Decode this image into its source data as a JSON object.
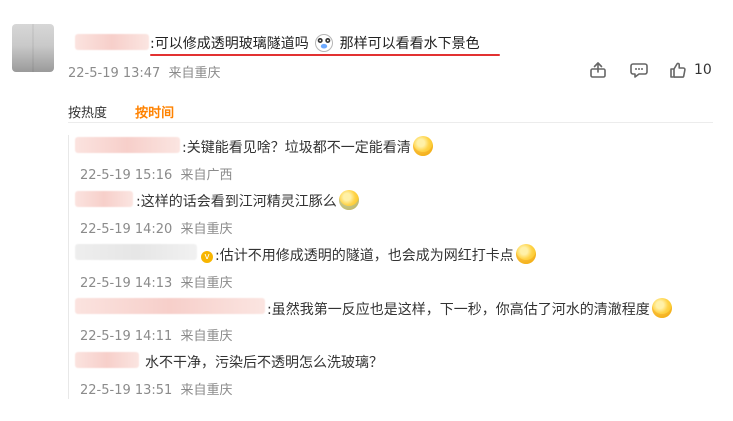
{
  "comment": {
    "text_before_emoji": ":可以修成透明玻璃隧道吗",
    "text_after_emoji": "那样可以看看水下景色",
    "date": "22-5-19 13:47",
    "location": "来自重庆",
    "like_count": "10",
    "icons": {
      "share": "share-icon",
      "comment": "comment-icon",
      "like": "thumbs-up-icon",
      "inline_emoji": "panda-emoji-icon"
    }
  },
  "tabs": [
    {
      "label": "按热度"
    },
    {
      "label": "按时间"
    }
  ],
  "replies": [
    {
      "text": ":关键能看见啥？垃圾都不一定能看清",
      "date": "22-5-19 15:16",
      "location": "来自广西"
    },
    {
      "text": ":这样的话会看到江河精灵江豚么",
      "date": "22-5-19 14:20",
      "location": "来自重庆"
    },
    {
      "text": ":估计不用修成透明的隧道，也会成为网红打卡点",
      "date": "22-5-19 14:13",
      "location": "来自重庆"
    },
    {
      "text": ":虽然我第一反应也是这样，下一秒，你高估了河水的清澈程度",
      "date": "22-5-19 14:11",
      "location": "来自重庆"
    },
    {
      "text": "水不干净，污染后不透明怎么洗玻璃？",
      "date": "22-5-19 13:51",
      "location": "来自重庆"
    }
  ],
  "colors": {
    "accent_orange": "#ff8200",
    "underline_red": "#e23131",
    "meta_gray": "#8b8b8b"
  }
}
